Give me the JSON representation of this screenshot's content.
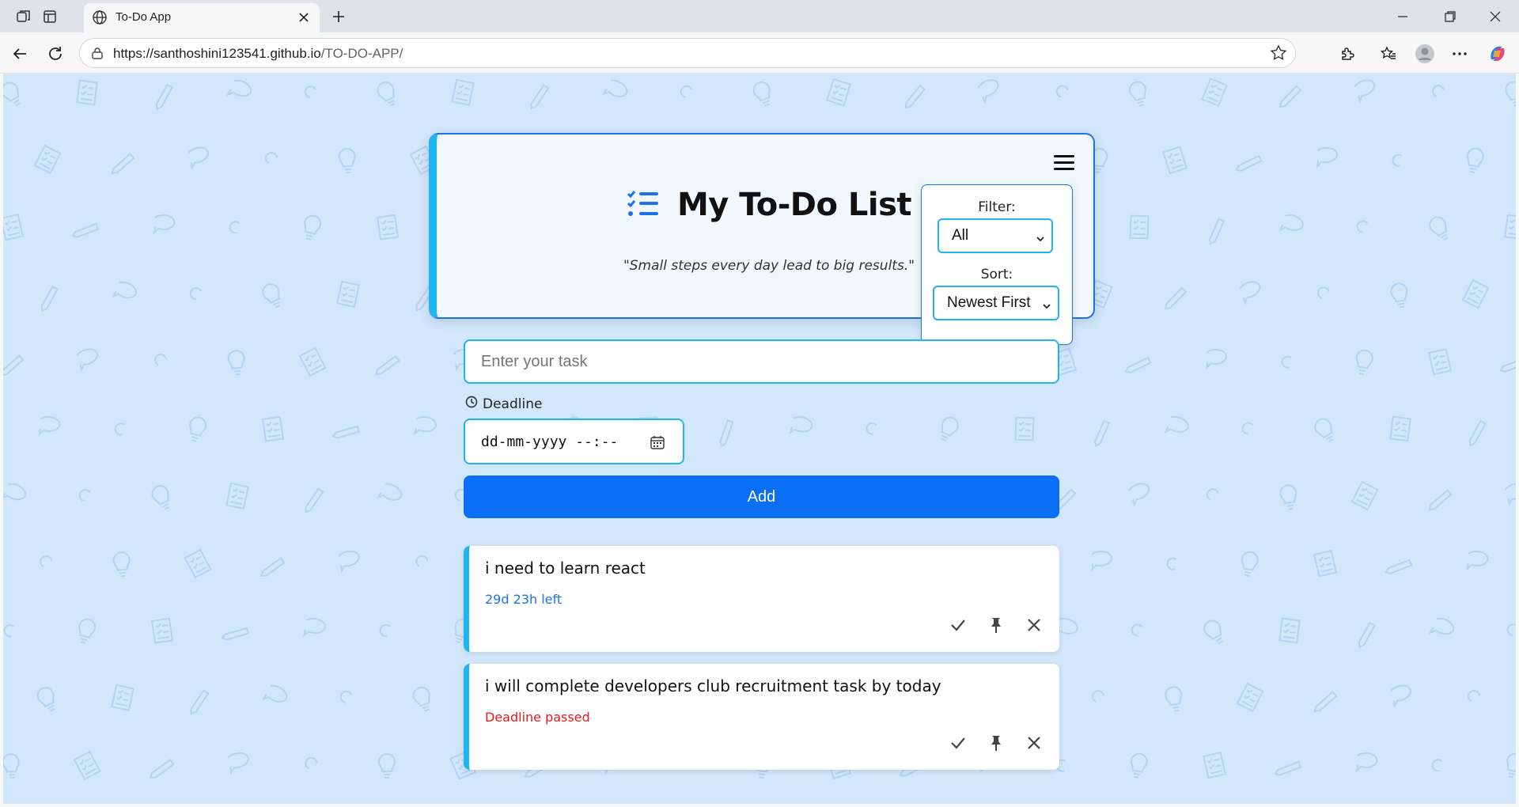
{
  "browser": {
    "tab_title": "To-Do App",
    "url_host": "https://santhoshini123541.github.io",
    "url_path": "/TO-DO-APP/"
  },
  "app": {
    "title": "My To-Do List",
    "quote": "\"Small steps every day lead to big results.\"",
    "filter_label": "Filter:",
    "filter_value": "All",
    "sort_label": "Sort:",
    "sort_value": "Newest First",
    "task_placeholder": "Enter your task",
    "deadline_label": "Deadline",
    "date_placeholder": "dd-mm-yyyy --:--",
    "add_label": "Add"
  },
  "tasks": [
    {
      "text": "i need to learn react",
      "status": "29d 23h left",
      "status_color": "#1a73e8"
    },
    {
      "text": "i will complete developers club recruitment task by today",
      "status": "Deadline passed",
      "status_color": "#e41b1b"
    }
  ],
  "colors": {
    "accent": "#0a6ff5",
    "border": "#1fb5f0",
    "background": "#d2e7fb"
  },
  "icons": [
    "workspaces-icon",
    "tab-actions-icon",
    "globe-icon",
    "close-icon",
    "plus-icon",
    "back-icon",
    "refresh-icon",
    "lock-icon",
    "star-icon",
    "extensions-icon",
    "favorites-icon",
    "profile-icon",
    "more-icon",
    "copilot-icon",
    "checklist-icon",
    "hamburger-icon",
    "clock-icon",
    "calendar-icon",
    "check-icon",
    "pin-icon",
    "delete-icon"
  ]
}
